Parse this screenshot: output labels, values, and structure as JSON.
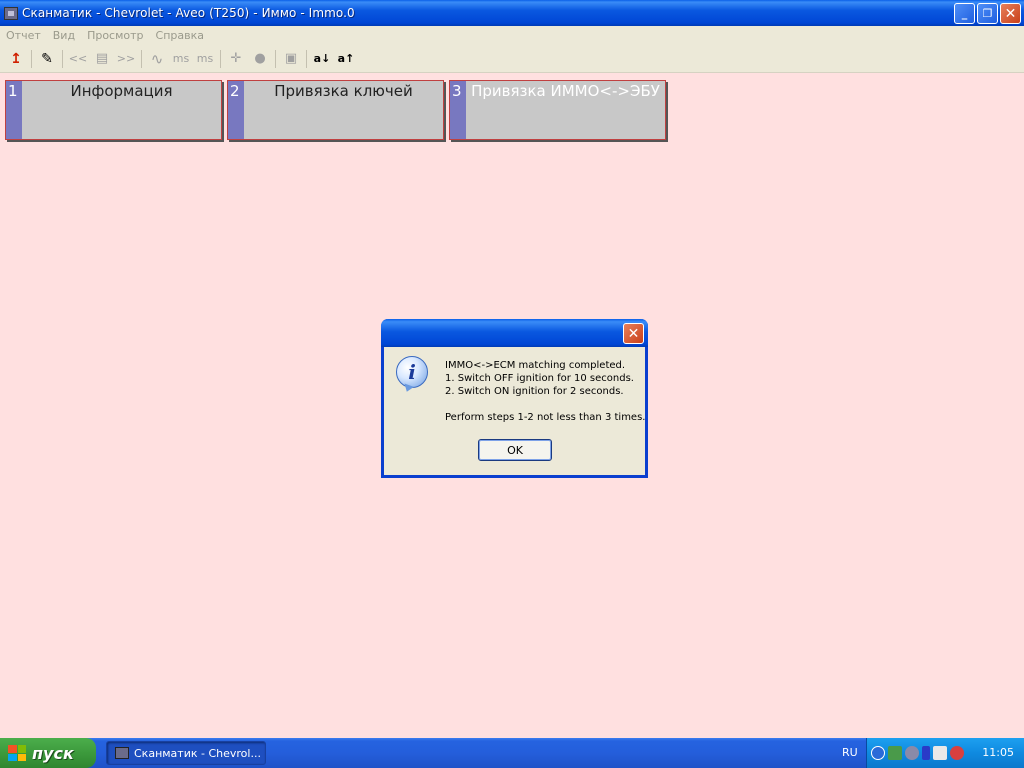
{
  "window": {
    "title": "Сканматик - Chevrolet - Aveo (T250) - Иммо - Immo.0",
    "minimize_label": "_",
    "maximize_label": "❐",
    "close_label": "✕"
  },
  "menu": {
    "items": [
      "Отчет",
      "Вид",
      "Просмотр",
      "Справка"
    ]
  },
  "toolbar": {
    "buttons": [
      {
        "icon": "exit-arrow-icon",
        "glyph": "↥"
      },
      {
        "icon": "notepad-icon",
        "glyph": "✎"
      },
      {
        "icon": "prev-icon",
        "glyph": "<<"
      },
      {
        "icon": "list-icon",
        "glyph": "▤"
      },
      {
        "icon": "next-icon",
        "glyph": ">>"
      },
      {
        "icon": "wave-icon",
        "glyph": "∿"
      },
      {
        "icon": "ms-minus-icon",
        "glyph": "ms"
      },
      {
        "icon": "ms-plus-icon",
        "glyph": "ms"
      },
      {
        "icon": "crosshair-icon",
        "glyph": "✛"
      },
      {
        "icon": "record-icon",
        "glyph": "●"
      },
      {
        "icon": "save-icon",
        "glyph": "▣"
      },
      {
        "icon": "font-decrease-icon",
        "glyph": "a↓"
      },
      {
        "icon": "font-increase-icon",
        "glyph": "a↑"
      }
    ]
  },
  "tabs": [
    {
      "number": "1",
      "label": "Информация"
    },
    {
      "number": "2",
      "label": "Привязка ключей"
    },
    {
      "number": "3",
      "label": "Привязка ИММО<->ЭБУ"
    }
  ],
  "dialog": {
    "close_label": "✕",
    "icon_glyph": "i",
    "line1": "IMMO<->ECM matching completed.",
    "line2": "1. Switch OFF ignition for 10 seconds.",
    "line3": "2. Switch ON ignition for 2 seconds.",
    "line4": "Perform steps 1-2 not less than 3 times.",
    "ok_label": "OK"
  },
  "taskbar": {
    "start_label": "пуск",
    "task_label": "Сканматик - Chevrol...",
    "language": "RU",
    "clock": "11:05"
  }
}
